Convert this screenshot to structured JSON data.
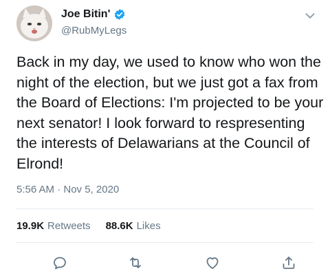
{
  "tweet": {
    "author": {
      "display_name": "Joe Bitin'",
      "handle": "@RubMyLegs",
      "verified": true
    },
    "text": "Back in my day, we used to know who won the night of the election, but we just got a fax from the Board of Elections: I'm projected to be your next senator! I look forward to respresenting the interests of Delawarians at the Council of Elrond!",
    "timestamp": "5:56 AM · Nov 5, 2020",
    "stats": {
      "retweets_count": "19.9K",
      "retweets_label": "Retweets",
      "likes_count": "88.6K",
      "likes_label": "Likes"
    }
  },
  "icons": {
    "verified": "verified-badge-icon",
    "menu": "chevron-down-icon",
    "reply": "reply-icon",
    "retweet": "retweet-icon",
    "like": "heart-icon",
    "share": "share-icon"
  },
  "colors": {
    "text_primary": "#14171a",
    "text_secondary": "#657786",
    "verified_blue": "#1da1f2",
    "icon_gray": "#657786",
    "divider": "#e6ecf0"
  }
}
